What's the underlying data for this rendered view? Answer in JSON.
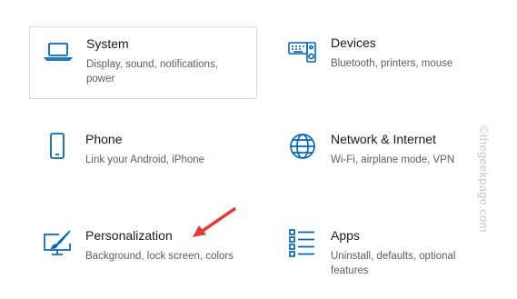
{
  "colors": {
    "accent": "#0067c0",
    "title_text": "#1a1a1a",
    "desc_text": "#5d5d5d",
    "arrow": "#e03a3a",
    "watermark": "#c8c8c8"
  },
  "tiles": [
    {
      "title": "System",
      "desc": "Display, sound, notifications, power",
      "icon": "laptop-icon"
    },
    {
      "title": "Devices",
      "desc": "Bluetooth, printers, mouse",
      "icon": "keyboard-speaker-icon"
    },
    {
      "title": "Phone",
      "desc": "Link your Android, iPhone",
      "icon": "phone-icon"
    },
    {
      "title": "Network & Internet",
      "desc": "Wi-Fi, airplane mode, VPN",
      "icon": "globe-icon"
    },
    {
      "title": "Personalization",
      "desc": "Background, lock screen, colors",
      "icon": "paint-brush-monitor-icon"
    },
    {
      "title": "Apps",
      "desc": "Uninstall, defaults, optional features",
      "icon": "apps-list-icon"
    }
  ],
  "watermark": "©thegeekpage.com"
}
